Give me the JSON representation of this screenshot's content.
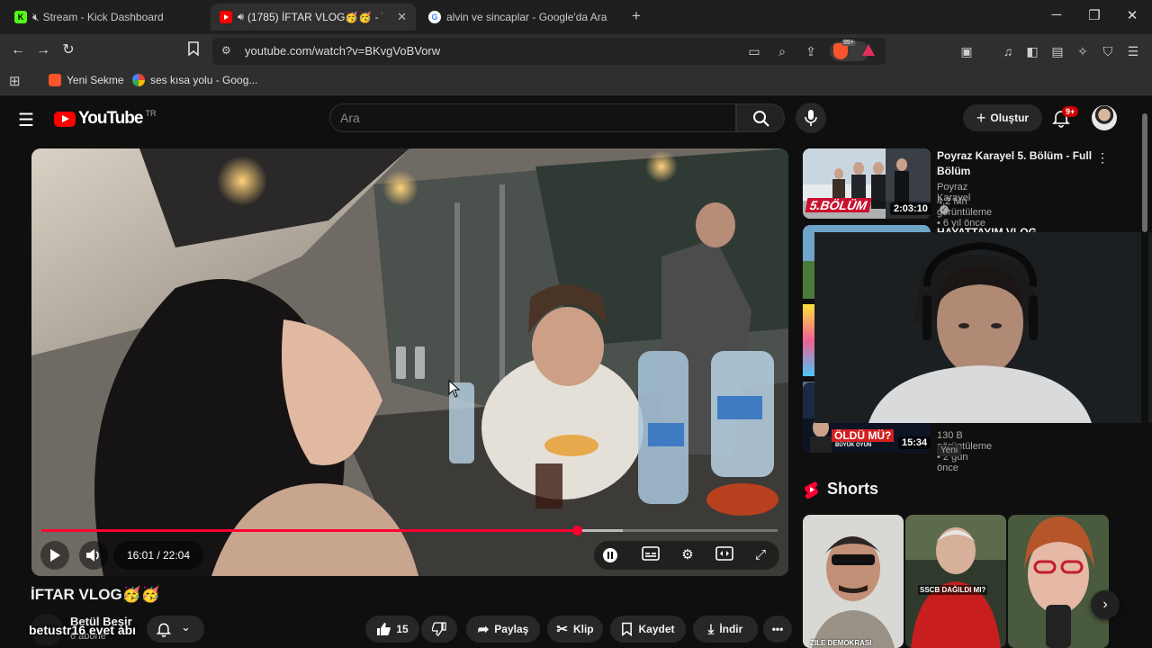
{
  "browser": {
    "tabs": [
      {
        "title": "Stream - Kick Dashboard",
        "icon": "kick-icon",
        "muted": true
      },
      {
        "title": "(1785) İFTAR VLOG🥳🥳 - Yo",
        "icon": "youtube-icon",
        "active": true
      },
      {
        "title": "alvin ve sincaplar - Google'da Ara",
        "icon": "google-icon"
      }
    ],
    "new_tab": "+",
    "url": "youtube.com/watch?v=BKvgVoBVorw",
    "brave_badge": "99+",
    "bookmarks": [
      {
        "label": "Yeni Sekme",
        "icon": "brave-icon"
      },
      {
        "label": "ses kısa yolu - Goog...",
        "icon": "google-icon"
      }
    ]
  },
  "youtube": {
    "logo": "YouTube",
    "country": "TR",
    "search_placeholder": "Ara",
    "create_label": "Oluştur",
    "notifications": "9+"
  },
  "player": {
    "time": "16:01 / 22:04",
    "progress": 0.727,
    "buffered": 0.79
  },
  "video": {
    "title": "İFTAR VLOG🥳🥳",
    "channel": "Betül Beşir",
    "subscribers": "6 abone",
    "likes": "15",
    "share": "Paylaş",
    "clip": "Klip",
    "save": "Kaydet",
    "download": "İndir"
  },
  "overlay_chat": "betustr16  evet abı",
  "recommendations": [
    {
      "title": "Poyraz Karayel 5. Bölüm - Full Bölüm",
      "channel": "Poyraz Karayel",
      "meta": "4,2 Mn görüntüleme • 6 yıl önce",
      "duration": "2:03:10",
      "thumb_text": "5.BÖLÜM"
    },
    {
      "title": "HAYATTAYIM VLOG",
      "channel": "",
      "meta": "",
      "duration": ""
    },
    {
      "title": "",
      "channel": "",
      "meta": "130 B görüntüleme • 2 gün önce",
      "badge": "Yeni",
      "duration": "15:34",
      "thumb_text": "ÖLDÜ MÜ?",
      "thumb_sub": "BÜYÜK OYUN"
    }
  ],
  "shorts": {
    "heading": "Shorts",
    "items": [
      {
        "caption": "ZILE DEMOKRASI"
      },
      {
        "caption": "SSCB DAĞILDI MI?"
      },
      {
        "caption": ""
      }
    ]
  },
  "colors": {
    "accent": "#ff0033",
    "background": "#0f0f0f",
    "surface": "#272727"
  }
}
